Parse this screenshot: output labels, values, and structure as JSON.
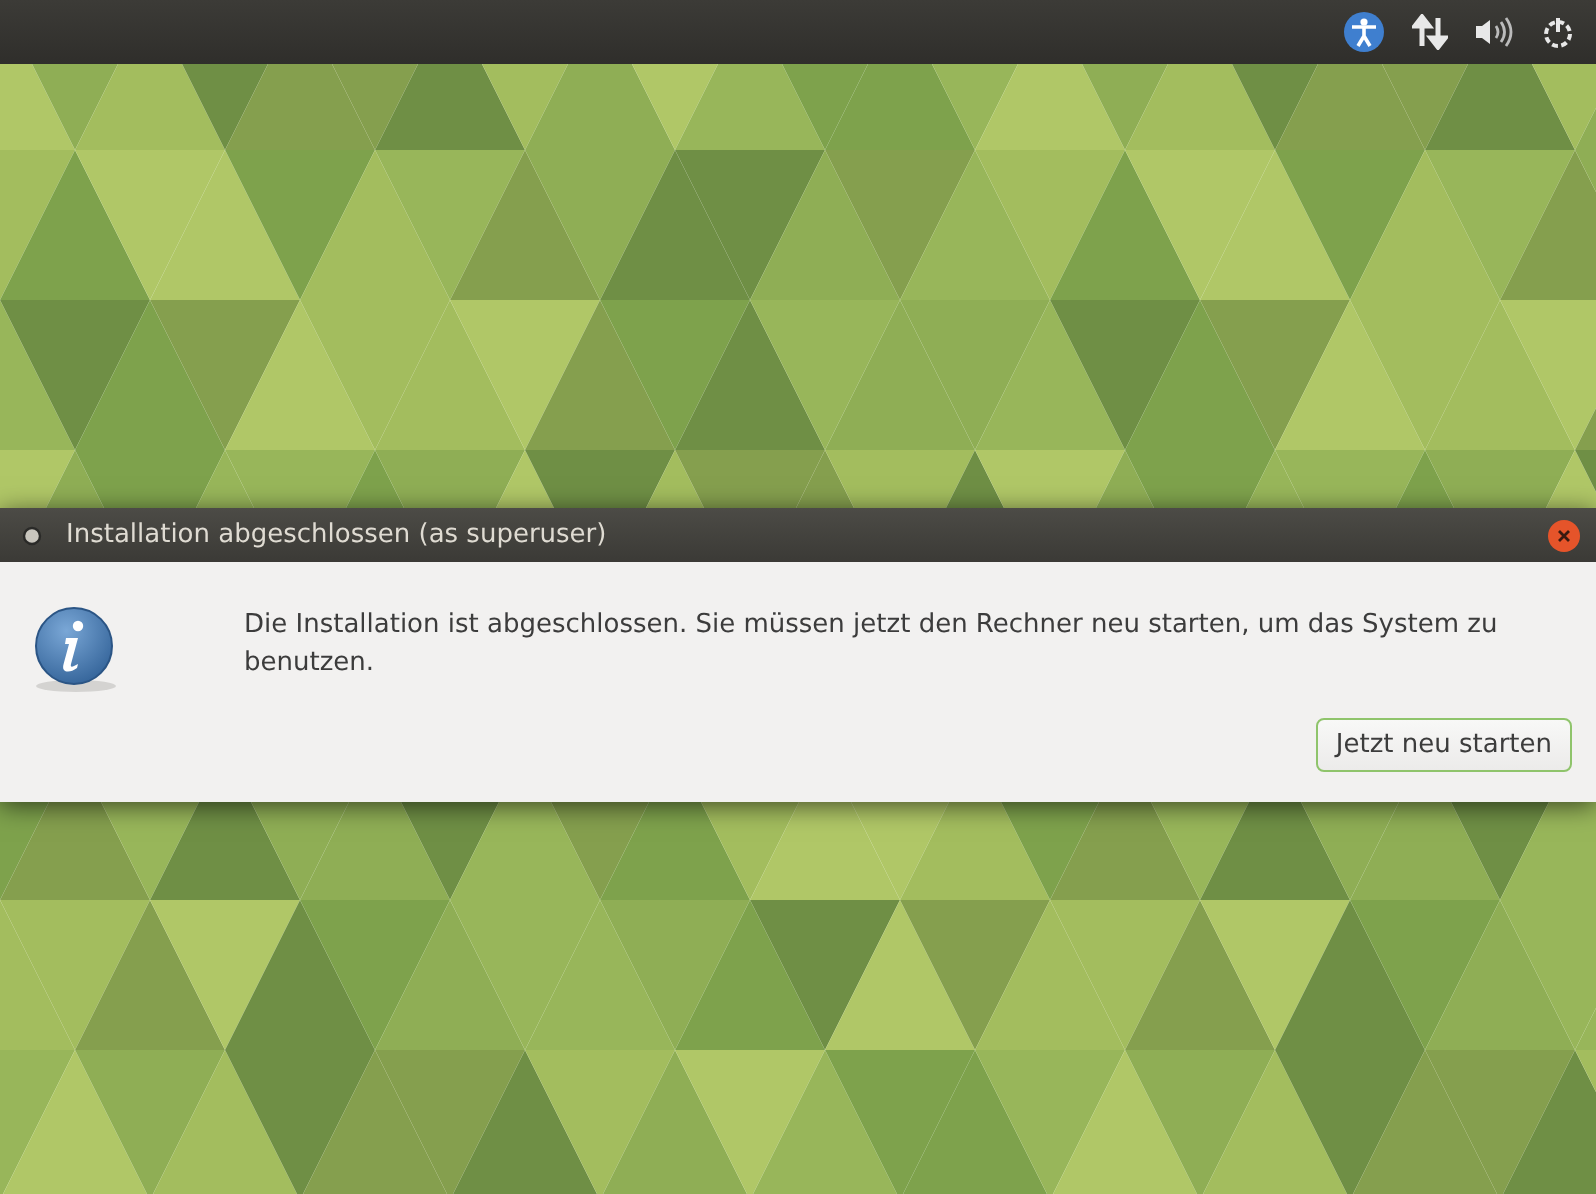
{
  "dialog": {
    "title": "Installation abgeschlossen (as superuser)",
    "message": "Die Installation ist abgeschlossen. Sie müssen jetzt den Rechner neu starten, um das System zu benutzen.",
    "button": "Jetzt neu starten"
  }
}
